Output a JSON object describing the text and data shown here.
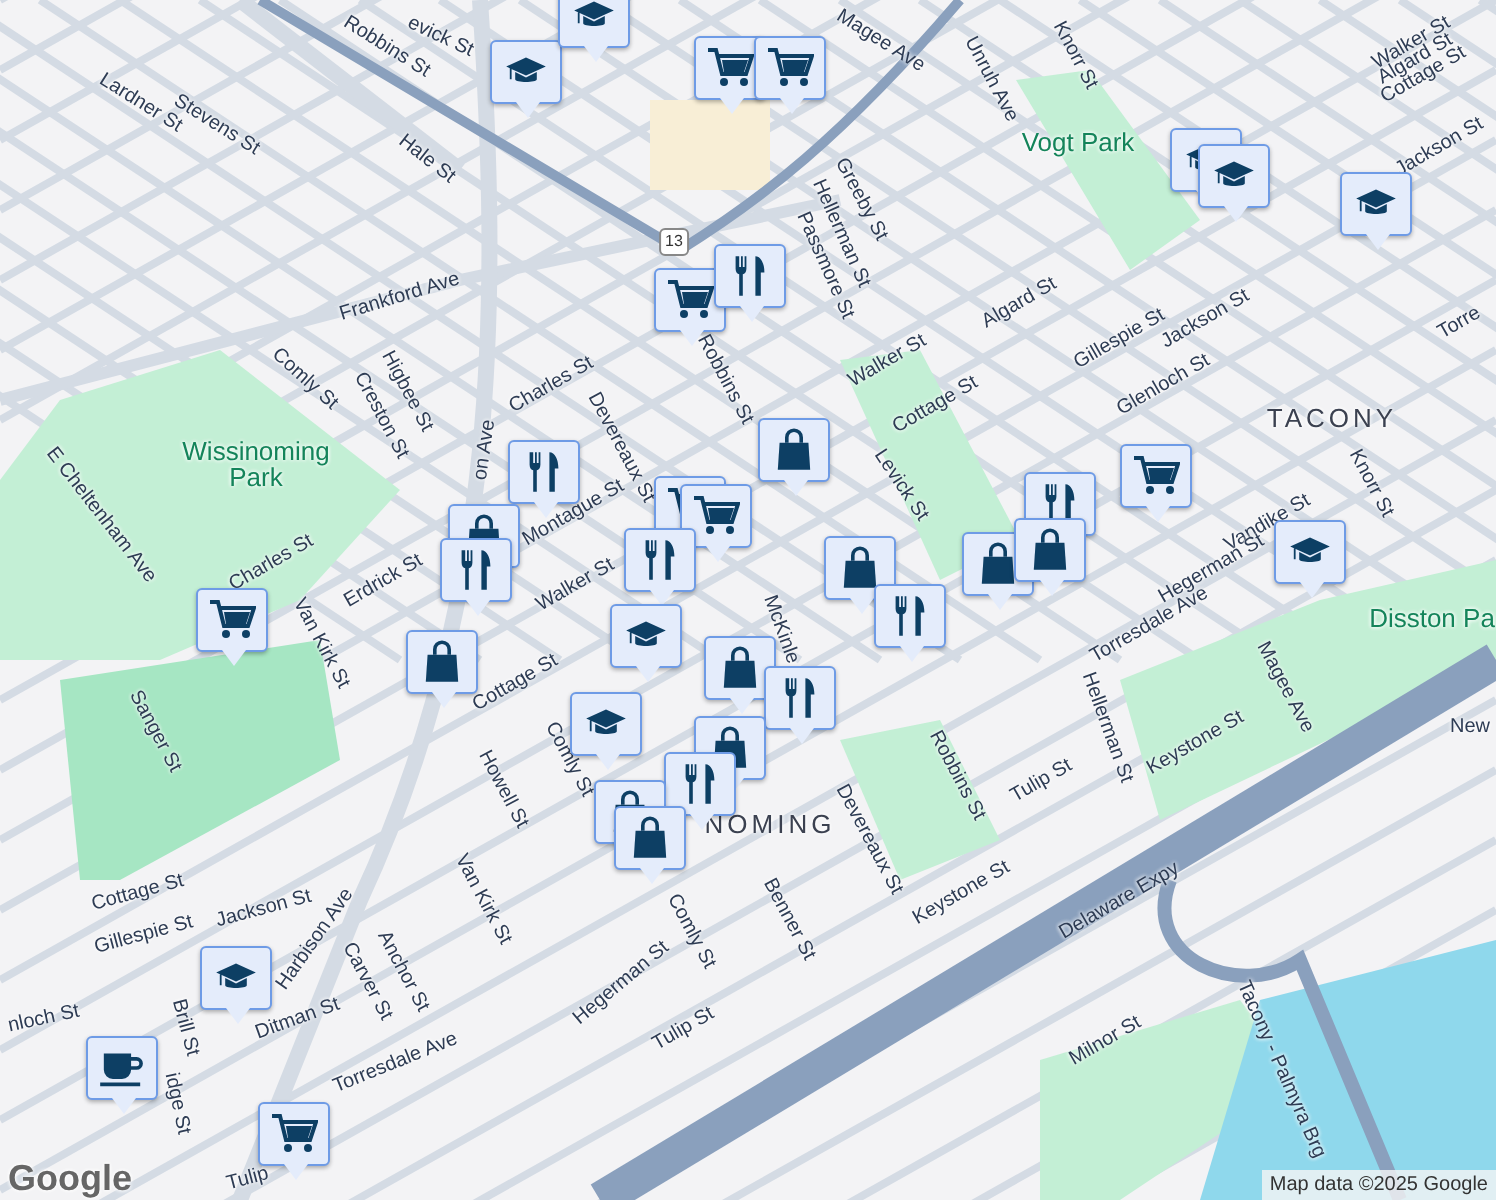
{
  "map": {
    "labels": [
      {
        "text": "evick St",
        "kind": "street"
      },
      {
        "text": "Robbins St",
        "kind": "street"
      },
      {
        "text": "Lardner St",
        "kind": "street"
      },
      {
        "text": "Stevens St",
        "kind": "street"
      },
      {
        "text": "Hale St",
        "kind": "street"
      },
      {
        "text": "Frankford Ave",
        "kind": "street"
      },
      {
        "text": "Comly St",
        "kind": "street"
      },
      {
        "text": "Creston St",
        "kind": "street"
      },
      {
        "text": "Higbee St",
        "kind": "street"
      },
      {
        "text": "Charles St",
        "kind": "street"
      },
      {
        "text": "Devereaux St",
        "kind": "street"
      },
      {
        "text": "Wissinoming Park",
        "kind": "park"
      },
      {
        "text": "E Cheltenham Ave",
        "kind": "street"
      },
      {
        "text": "Robbins St",
        "kind": "street"
      },
      {
        "text": "Magee Ave",
        "kind": "street"
      },
      {
        "text": "Unruh Ave",
        "kind": "street"
      },
      {
        "text": "Knorr St",
        "kind": "street"
      },
      {
        "text": "Vogt Park",
        "kind": "park"
      },
      {
        "text": "Greeby St",
        "kind": "street"
      },
      {
        "text": "Hellerman St",
        "kind": "street"
      },
      {
        "text": "Passmore St",
        "kind": "street"
      },
      {
        "text": "Walker St",
        "kind": "street"
      },
      {
        "text": "Algard St",
        "kind": "street"
      },
      {
        "text": "Cottage St",
        "kind": "street"
      },
      {
        "text": "Gillespie St",
        "kind": "street"
      },
      {
        "text": "Jackson St",
        "kind": "street"
      },
      {
        "text": "Glenloch St",
        "kind": "street"
      },
      {
        "text": "Cottage St",
        "kind": "street"
      },
      {
        "text": "Walker St",
        "kind": "street"
      },
      {
        "text": "Algard St",
        "kind": "street"
      },
      {
        "text": "Jackson St",
        "kind": "street"
      },
      {
        "text": "Torre",
        "kind": "street"
      },
      {
        "text": "TACONY",
        "kind": "area"
      },
      {
        "text": "Levick St",
        "kind": "street"
      },
      {
        "text": "Knorr St",
        "kind": "street"
      },
      {
        "text": "Torresdale Ave",
        "kind": "street"
      },
      {
        "text": "Vandike St",
        "kind": "street"
      },
      {
        "text": "Hegerman St",
        "kind": "street"
      },
      {
        "text": "Hellerman St",
        "kind": "street"
      },
      {
        "text": "Disston Pa",
        "kind": "park"
      },
      {
        "text": "Magee Ave",
        "kind": "street"
      },
      {
        "text": "New",
        "kind": "street"
      },
      {
        "text": "Keystone St",
        "kind": "street"
      },
      {
        "text": "Tulip St",
        "kind": "street"
      },
      {
        "text": "Robbins St",
        "kind": "street"
      },
      {
        "text": "Devereaux St",
        "kind": "street"
      },
      {
        "text": "NOMING",
        "kind": "area"
      },
      {
        "text": "Benner St",
        "kind": "street"
      },
      {
        "text": "Keystone St",
        "kind": "street"
      },
      {
        "text": "Delaware Expy",
        "kind": "street"
      },
      {
        "text": "Tacony - Palmyra Brg",
        "kind": "street"
      },
      {
        "text": "Milnor St",
        "kind": "street"
      },
      {
        "text": "Charles St",
        "kind": "street"
      },
      {
        "text": "Van Kirk St",
        "kind": "street"
      },
      {
        "text": "Erdrick St",
        "kind": "street"
      },
      {
        "text": "Montague St",
        "kind": "street"
      },
      {
        "text": "Walker St",
        "kind": "street"
      },
      {
        "text": "Cottage St",
        "kind": "street"
      },
      {
        "text": "Comly St",
        "kind": "street"
      },
      {
        "text": "Howell St",
        "kind": "street"
      },
      {
        "text": "McKinle",
        "kind": "street"
      },
      {
        "text": "Sanger St",
        "kind": "street"
      },
      {
        "text": "Van Kirk St",
        "kind": "street"
      },
      {
        "text": "Cottage St",
        "kind": "street"
      },
      {
        "text": "Gillespie St",
        "kind": "street"
      },
      {
        "text": "Jackson St",
        "kind": "street"
      },
      {
        "text": "Harbison Ave",
        "kind": "street"
      },
      {
        "text": "Anchor St",
        "kind": "street"
      },
      {
        "text": "Carver St",
        "kind": "street"
      },
      {
        "text": "Ditman St",
        "kind": "street"
      },
      {
        "text": "nloch St",
        "kind": "street"
      },
      {
        "text": "Brill St",
        "kind": "street"
      },
      {
        "text": "Hegerman St",
        "kind": "street"
      },
      {
        "text": "Comly St",
        "kind": "street"
      },
      {
        "text": "Tulip St",
        "kind": "street"
      },
      {
        "text": "Torresdale Ave",
        "kind": "street"
      },
      {
        "text": "Tulip",
        "kind": "street"
      },
      {
        "text": "idge St",
        "kind": "street"
      },
      {
        "text": "on Ave",
        "kind": "street"
      },
      {
        "text": "13",
        "kind": "shield"
      }
    ],
    "markers": [
      {
        "kind": "school"
      },
      {
        "kind": "school"
      },
      {
        "kind": "grocery"
      },
      {
        "kind": "grocery"
      },
      {
        "kind": "grocery"
      },
      {
        "kind": "restaurant"
      },
      {
        "kind": "school"
      },
      {
        "kind": "school"
      },
      {
        "kind": "school"
      },
      {
        "kind": "shopping"
      },
      {
        "kind": "grocery"
      },
      {
        "kind": "restaurant"
      },
      {
        "kind": "grocery"
      },
      {
        "kind": "grocery"
      },
      {
        "kind": "shopping"
      },
      {
        "kind": "restaurant"
      },
      {
        "kind": "restaurant"
      },
      {
        "kind": "shopping"
      },
      {
        "kind": "restaurant"
      },
      {
        "kind": "restaurant"
      },
      {
        "kind": "shopping"
      },
      {
        "kind": "shopping"
      },
      {
        "kind": "school"
      },
      {
        "kind": "grocery"
      },
      {
        "kind": "shopping"
      },
      {
        "kind": "school"
      },
      {
        "kind": "shopping"
      },
      {
        "kind": "restaurant"
      },
      {
        "kind": "school"
      },
      {
        "kind": "shopping"
      },
      {
        "kind": "restaurant"
      },
      {
        "kind": "shopping"
      },
      {
        "kind": "shopping"
      },
      {
        "kind": "cafe"
      },
      {
        "kind": "school"
      },
      {
        "kind": "grocery"
      }
    ],
    "logo": "Google",
    "attribution": "Map data ©2025 Google"
  }
}
